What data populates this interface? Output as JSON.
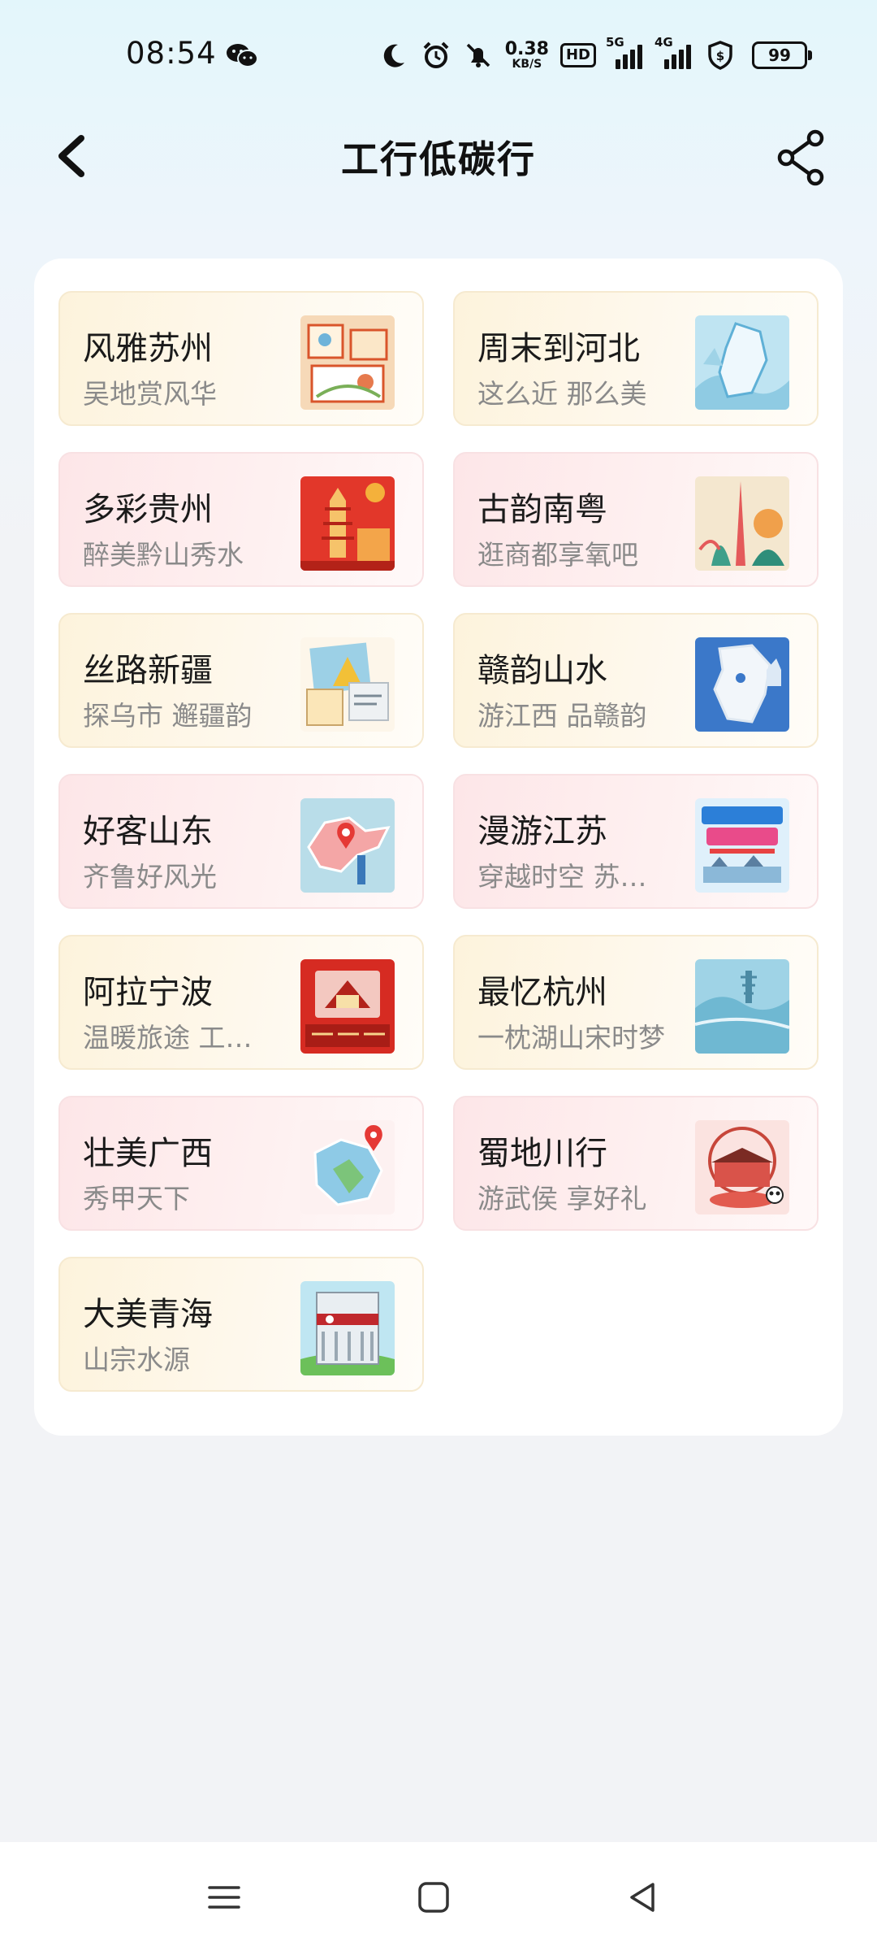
{
  "status_bar": {
    "time": "08:54",
    "net_speed_value": "0.38",
    "net_speed_unit": "KB/S",
    "hd_label": "HD",
    "signal1_label": "5G",
    "signal2_label": "4G",
    "battery": "99"
  },
  "header": {
    "title": "工行低碳行"
  },
  "tiles": [
    {
      "title": "风雅苏州",
      "subtitle": "吴地赏风华",
      "image": "suzhou-illustration"
    },
    {
      "title": "周末到河北",
      "subtitle": "这么近 那么美",
      "image": "hebei-map"
    },
    {
      "title": "多彩贵州",
      "subtitle": "醉美黔山秀水",
      "image": "guizhou-illustration"
    },
    {
      "title": "古韵南粤",
      "subtitle": "逛商都享氧吧",
      "image": "guangdong-illustration"
    },
    {
      "title": "丝路新疆",
      "subtitle": "探乌市 邂疆韵",
      "image": "xinjiang-illustration"
    },
    {
      "title": "赣韵山水",
      "subtitle": "游江西 品赣韵",
      "image": "jiangxi-map"
    },
    {
      "title": "好客山东",
      "subtitle": "齐鲁好风光",
      "image": "shandong-map"
    },
    {
      "title": "漫游江苏",
      "subtitle": "穿越时空 苏韵…",
      "image": "jiangsu-poster"
    },
    {
      "title": "阿拉宁波",
      "subtitle": "温暖旅途 工行…",
      "image": "ningbo-poster"
    },
    {
      "title": "最忆杭州",
      "subtitle": "一枕湖山宋时梦",
      "image": "hangzhou-scene"
    },
    {
      "title": "壮美广西",
      "subtitle": "秀甲天下",
      "image": "guangxi-map"
    },
    {
      "title": "蜀地川行",
      "subtitle": "游武侯 享好礼",
      "image": "sichuan-illustration"
    },
    {
      "title": "大美青海",
      "subtitle": "山宗水源",
      "image": "qinghai-bank-building"
    }
  ],
  "colors": {
    "gold_tile": "#fdf3dc",
    "pink_tile": "#fde6e8",
    "subtitle_text": "#8a8a8a"
  }
}
